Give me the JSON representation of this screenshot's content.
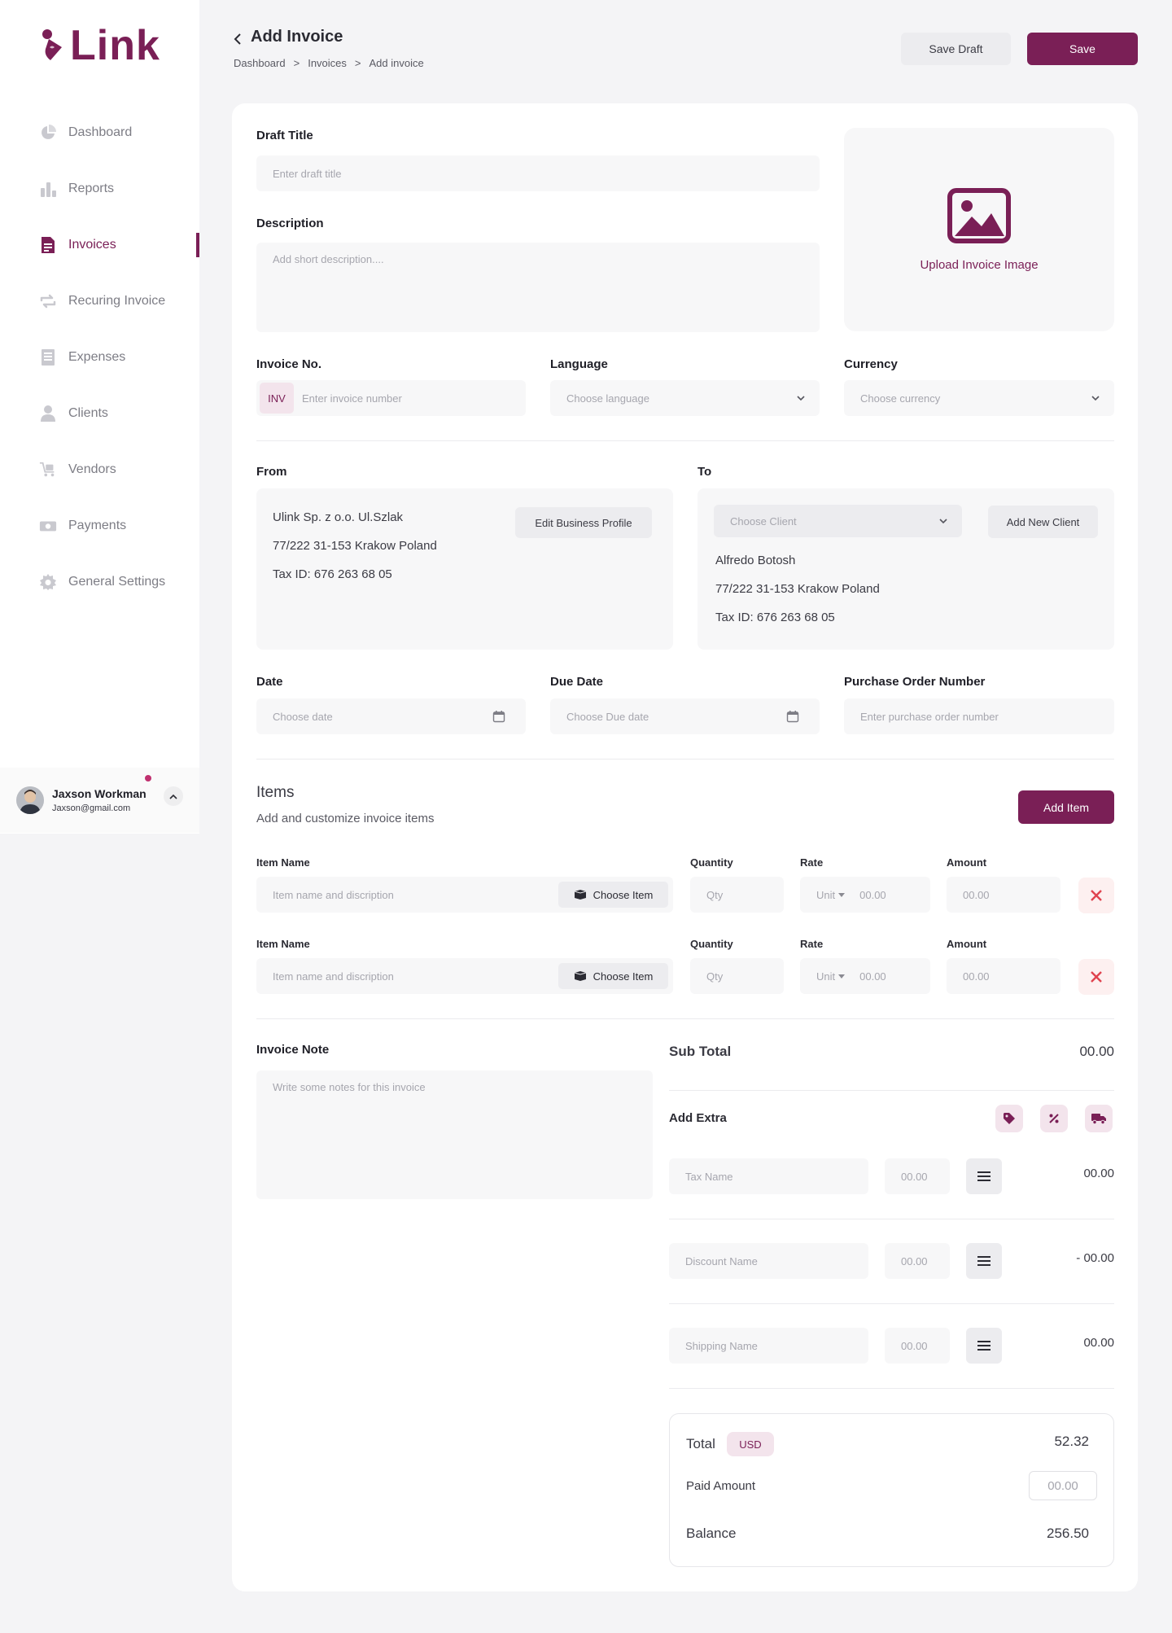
{
  "brand": {
    "name": "Link",
    "color": "#7a1f56"
  },
  "sidebar": {
    "items": [
      {
        "label": "Dashboard",
        "icon": "pie-chart-icon"
      },
      {
        "label": "Reports",
        "icon": "bar-chart-icon"
      },
      {
        "label": "Invoices",
        "icon": "invoice-icon",
        "active": true
      },
      {
        "label": "Recuring Invoice",
        "icon": "repeat-icon"
      },
      {
        "label": "Expenses",
        "icon": "receipt-icon"
      },
      {
        "label": "Clients",
        "icon": "user-icon"
      },
      {
        "label": "Vendors",
        "icon": "cart-icon"
      },
      {
        "label": "Payments",
        "icon": "money-icon"
      },
      {
        "label": "General Settings",
        "icon": "gear-icon"
      }
    ],
    "user": {
      "name": "Jaxson Workman",
      "email": "Jaxson@gmail.com"
    }
  },
  "header": {
    "title": "Add Invoice",
    "breadcrumb": [
      "Dashboard",
      ">",
      "Invoices",
      ">",
      "Add invoice"
    ],
    "save_draft": "Save Draft",
    "save": "Save"
  },
  "form": {
    "draft_title": {
      "label": "Draft Title",
      "placeholder": "Enter draft title"
    },
    "description": {
      "label": "Description",
      "placeholder": "Add short description...."
    },
    "upload": {
      "label": "Upload Invoice Image"
    },
    "invoice_no": {
      "label": "Invoice No.",
      "prefix": "INV",
      "placeholder": "Enter invoice number"
    },
    "language": {
      "label": "Language",
      "placeholder": "Choose language"
    },
    "currency": {
      "label": "Currency",
      "placeholder": "Choose currency"
    },
    "from": {
      "label": "From",
      "lines": [
        "Ulink Sp. z o.o. Ul.Szlak",
        "77/222 31-153 Krakow Poland",
        "Tax ID: 676 263 68 05"
      ],
      "edit_button": "Edit Business Profile"
    },
    "to": {
      "label": "To",
      "choose_client": "Choose Client",
      "add_client": "Add New Client",
      "lines": [
        "Alfredo Botosh",
        "77/222 31-153 Krakow Poland",
        "Tax ID: 676 263 68 05"
      ]
    },
    "date": {
      "label": "Date",
      "placeholder": "Choose date"
    },
    "due_date": {
      "label": "Due Date",
      "placeholder": "Choose Due date"
    },
    "po_number": {
      "label": "Purchase Order Number",
      "placeholder": "Enter purchase order number"
    }
  },
  "items": {
    "title": "Items",
    "subtitle": "Add and customize invoice items",
    "add_button": "Add Item",
    "columns": {
      "name": "Item Name",
      "quantity": "Quantity",
      "rate": "Rate",
      "amount": "Amount"
    },
    "rows": [
      {
        "name_placeholder": "Item name and discription",
        "choose": "Choose Item",
        "qty_placeholder": "Qty",
        "unit": "Unit",
        "rate_placeholder": "00.00",
        "amount_placeholder": "00.00"
      },
      {
        "name_placeholder": "Item name and discription",
        "choose": "Choose Item",
        "qty_placeholder": "Qty",
        "unit": "Unit",
        "rate_placeholder": "00.00",
        "amount_placeholder": "00.00"
      }
    ]
  },
  "note": {
    "label": "Invoice Note",
    "placeholder": "Write some notes for this invoice"
  },
  "summary": {
    "subtotal_label": "Sub Total",
    "subtotal_value": "00.00",
    "add_extra_label": "Add Extra",
    "extras": [
      {
        "name_placeholder": "Tax Name",
        "value_placeholder": "00.00",
        "result": "00.00"
      },
      {
        "name_placeholder": "Discount Name",
        "value_placeholder": "00.00",
        "result": "- 00.00"
      },
      {
        "name_placeholder": "Shipping Name",
        "value_placeholder": "00.00",
        "result": "00.00"
      }
    ],
    "total_label": "Total",
    "currency_badge": "USD",
    "total_value": "52.32",
    "paid_label": "Paid Amount",
    "paid_placeholder": "00.00",
    "balance_label": "Balance",
    "balance_value": "256.50"
  }
}
